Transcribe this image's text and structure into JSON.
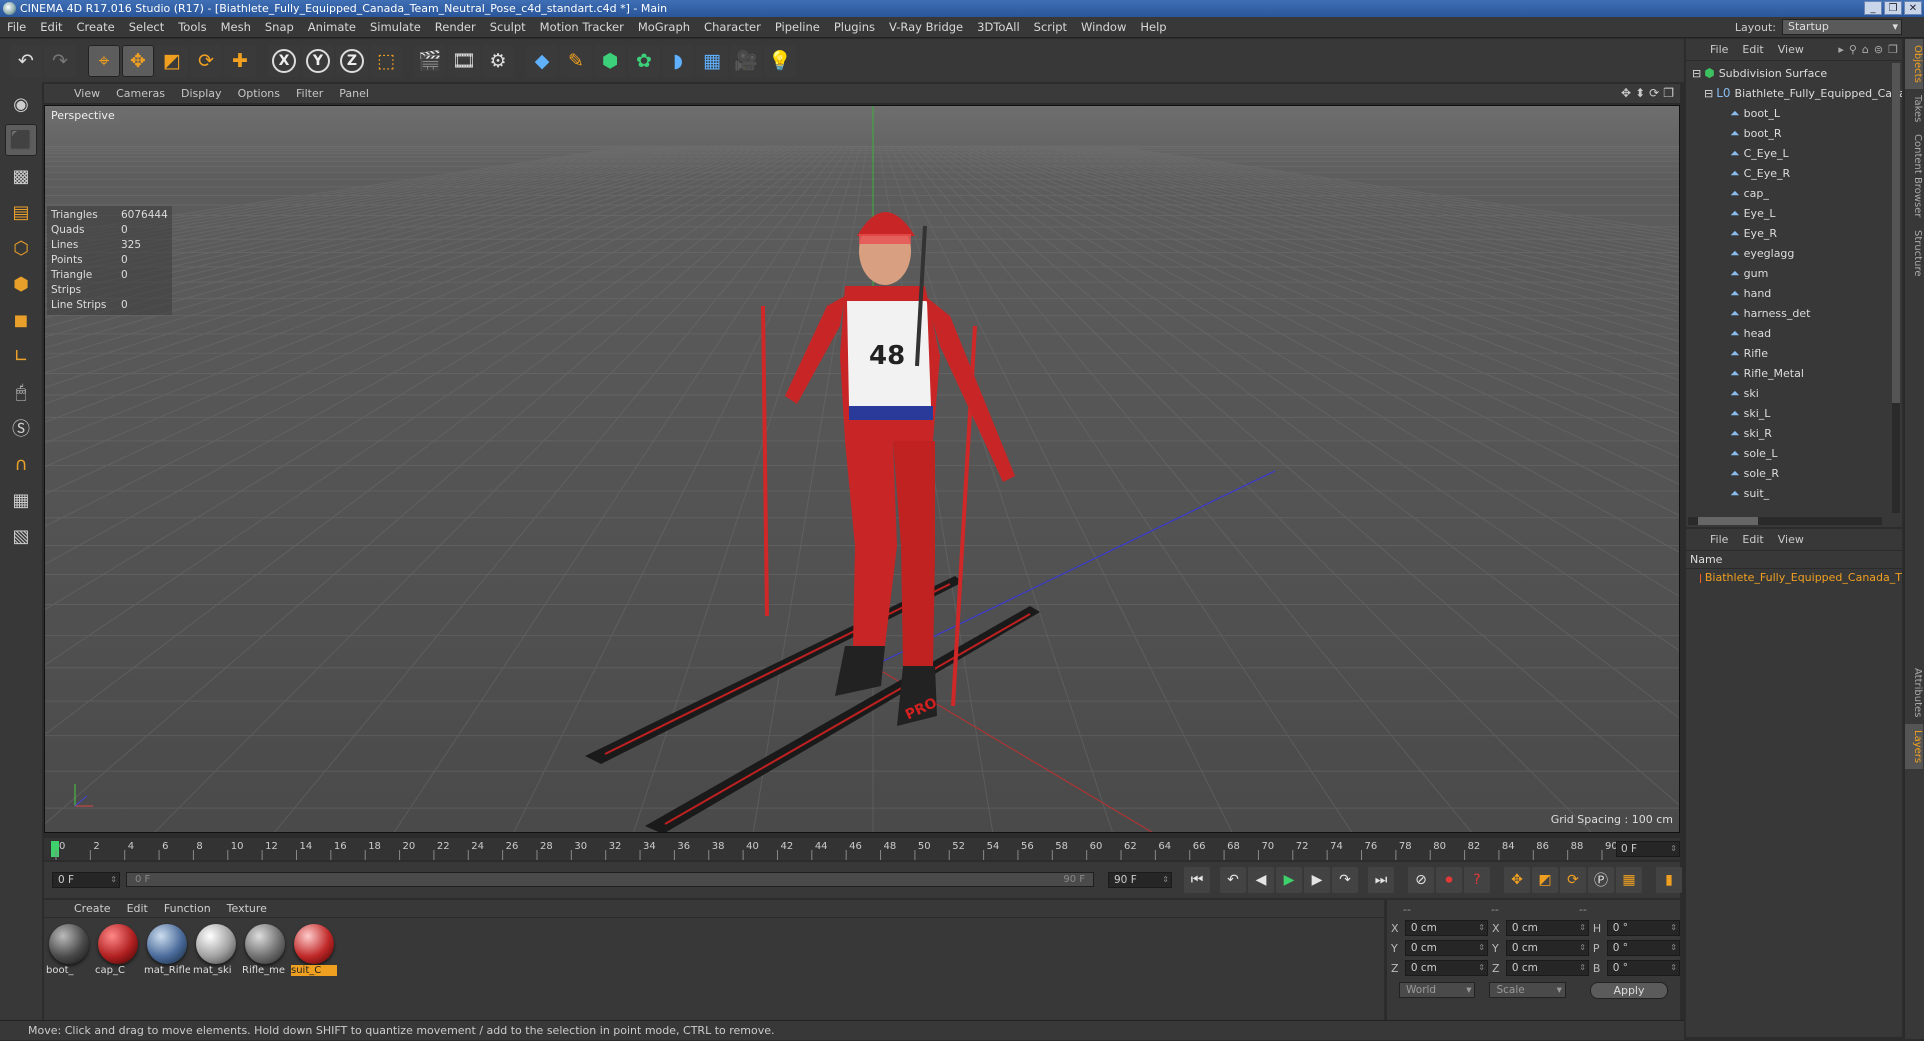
{
  "window": {
    "title": "CINEMA 4D R17.016 Studio (R17) - [Biathlete_Fully_Equipped_Canada_Team_Neutral_Pose_c4d_standart.c4d *] - Main",
    "buttons": [
      "_",
      "❐",
      "✕"
    ]
  },
  "menu": [
    "File",
    "Edit",
    "Create",
    "Select",
    "Tools",
    "Mesh",
    "Snap",
    "Animate",
    "Simulate",
    "Render",
    "Sculpt",
    "Motion Tracker",
    "MoGraph",
    "Character",
    "Pipeline",
    "Plugins",
    "V-Ray Bridge",
    "3DToAll",
    "Script",
    "Window",
    "Help"
  ],
  "layout": {
    "label": "Layout:",
    "value": "Startup"
  },
  "viewport": {
    "menu": [
      "View",
      "Cameras",
      "Display",
      "Options",
      "Filter",
      "Panel"
    ],
    "label": "Perspective",
    "stats": [
      {
        "k": "Triangles",
        "v": "6076444"
      },
      {
        "k": "Quads",
        "v": "0"
      },
      {
        "k": "Lines",
        "v": "325"
      },
      {
        "k": "Points",
        "v": "0"
      },
      {
        "k": "Triangle Strips",
        "v": "0"
      },
      {
        "k": "Line Strips",
        "v": "0"
      }
    ],
    "grid_spacing": "Grid Spacing : 100 cm",
    "bib": "48",
    "boot_text": "PRO"
  },
  "timeline": {
    "ticks": [
      "0",
      "2",
      "4",
      "6",
      "8",
      "10",
      "12",
      "14",
      "16",
      "18",
      "20",
      "22",
      "24",
      "26",
      "28",
      "30",
      "32",
      "34",
      "36",
      "38",
      "40",
      "42",
      "44",
      "46",
      "48",
      "50",
      "52",
      "54",
      "56",
      "58",
      "60",
      "62",
      "64",
      "66",
      "68",
      "70",
      "72",
      "74",
      "76",
      "78",
      "80",
      "82",
      "84",
      "86",
      "88",
      "90"
    ],
    "frame": "0 F"
  },
  "transport": {
    "start": "0 F",
    "slider_left": "0 F",
    "slider_right": "90 F",
    "end": "90 F"
  },
  "materials": {
    "menu": [
      "Create",
      "Edit",
      "Function",
      "Texture"
    ],
    "items": [
      {
        "name": "boot_",
        "color": "#4a4a4a"
      },
      {
        "name": "cap_C",
        "color": "#b02020"
      },
      {
        "name": "mat_Rifle",
        "color": "#4a6a9a"
      },
      {
        "name": "mat_ski",
        "color": "#a0a0a0"
      },
      {
        "name": "Rifle_me",
        "color": "#707070"
      },
      {
        "name": "suit_C",
        "color": "#c02828",
        "selected": true
      }
    ]
  },
  "coords": {
    "headers": [
      "--",
      "--",
      "--"
    ],
    "rows": [
      {
        "a": "X",
        "v1": "0 cm",
        "b": "X",
        "v2": "0 cm",
        "c": "H",
        "v3": "0 °"
      },
      {
        "a": "Y",
        "v1": "0 cm",
        "b": "Y",
        "v2": "0 cm",
        "c": "P",
        "v3": "0 °"
      },
      {
        "a": "Z",
        "v1": "0 cm",
        "b": "Z",
        "v2": "0 cm",
        "c": "B",
        "v3": "0 °"
      }
    ],
    "world": "World",
    "scale": "Scale",
    "apply": "Apply"
  },
  "status": "Move: Click and drag to move elements. Hold down SHIFT to quantize movement / add to the selection in point mode, CTRL to remove.",
  "objects": {
    "menu": [
      "File",
      "Edit",
      "View"
    ],
    "root": "Subdivision Surface",
    "group": "Biathlete_Fully_Equipped_Canada",
    "children": [
      "boot_L",
      "boot_R",
      "C_Eye_L",
      "C_Eye_R",
      "cap_",
      "Eye_L",
      "Eye_R",
      "eyeglagg",
      "gum",
      "hand",
      "harness_det",
      "head",
      "Rifle",
      "Rifle_Metal",
      "ski",
      "ski_L",
      "ski_R",
      "sole_L",
      "sole_R",
      "suit_"
    ]
  },
  "layers": {
    "menu": [
      "File",
      "Edit",
      "View"
    ],
    "name_header": "Name",
    "item": "Biathlete_Fully_Equipped_Canada_T"
  },
  "right_tabs": [
    "Objects",
    "Takes",
    "Content Browser",
    "Structure",
    "Attributes",
    "Layers"
  ]
}
